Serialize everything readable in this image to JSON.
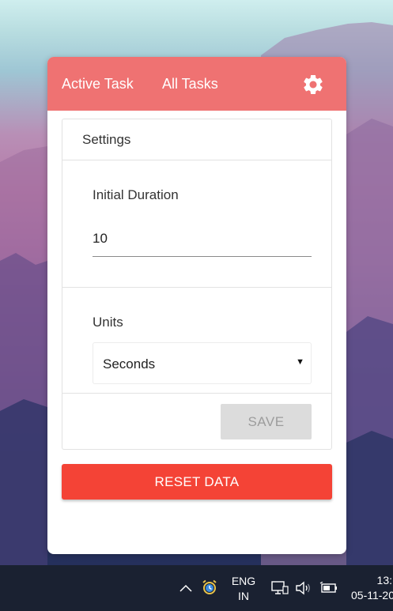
{
  "header": {
    "tabs": [
      {
        "label": "Active Task"
      },
      {
        "label": "All Tasks"
      }
    ],
    "settings_icon": "gear-icon"
  },
  "settings": {
    "title": "Settings",
    "initial_duration": {
      "label": "Initial Duration",
      "value": "10"
    },
    "units": {
      "label": "Units",
      "selected": "Seconds"
    },
    "save_label": "SAVE"
  },
  "reset_label": "RESET DATA",
  "taskbar": {
    "language_line1": "ENG",
    "language_line2": "IN",
    "time": "13:",
    "date": "05-11-20",
    "icons": [
      "chevron-up-icon",
      "alarm-clock-icon",
      "network-icon",
      "volume-icon",
      "battery-icon"
    ]
  },
  "colors": {
    "header": "#ef7272",
    "reset_button": "#f44336",
    "save_button_disabled": "#dcdcdc",
    "taskbar": "#1a2131"
  }
}
